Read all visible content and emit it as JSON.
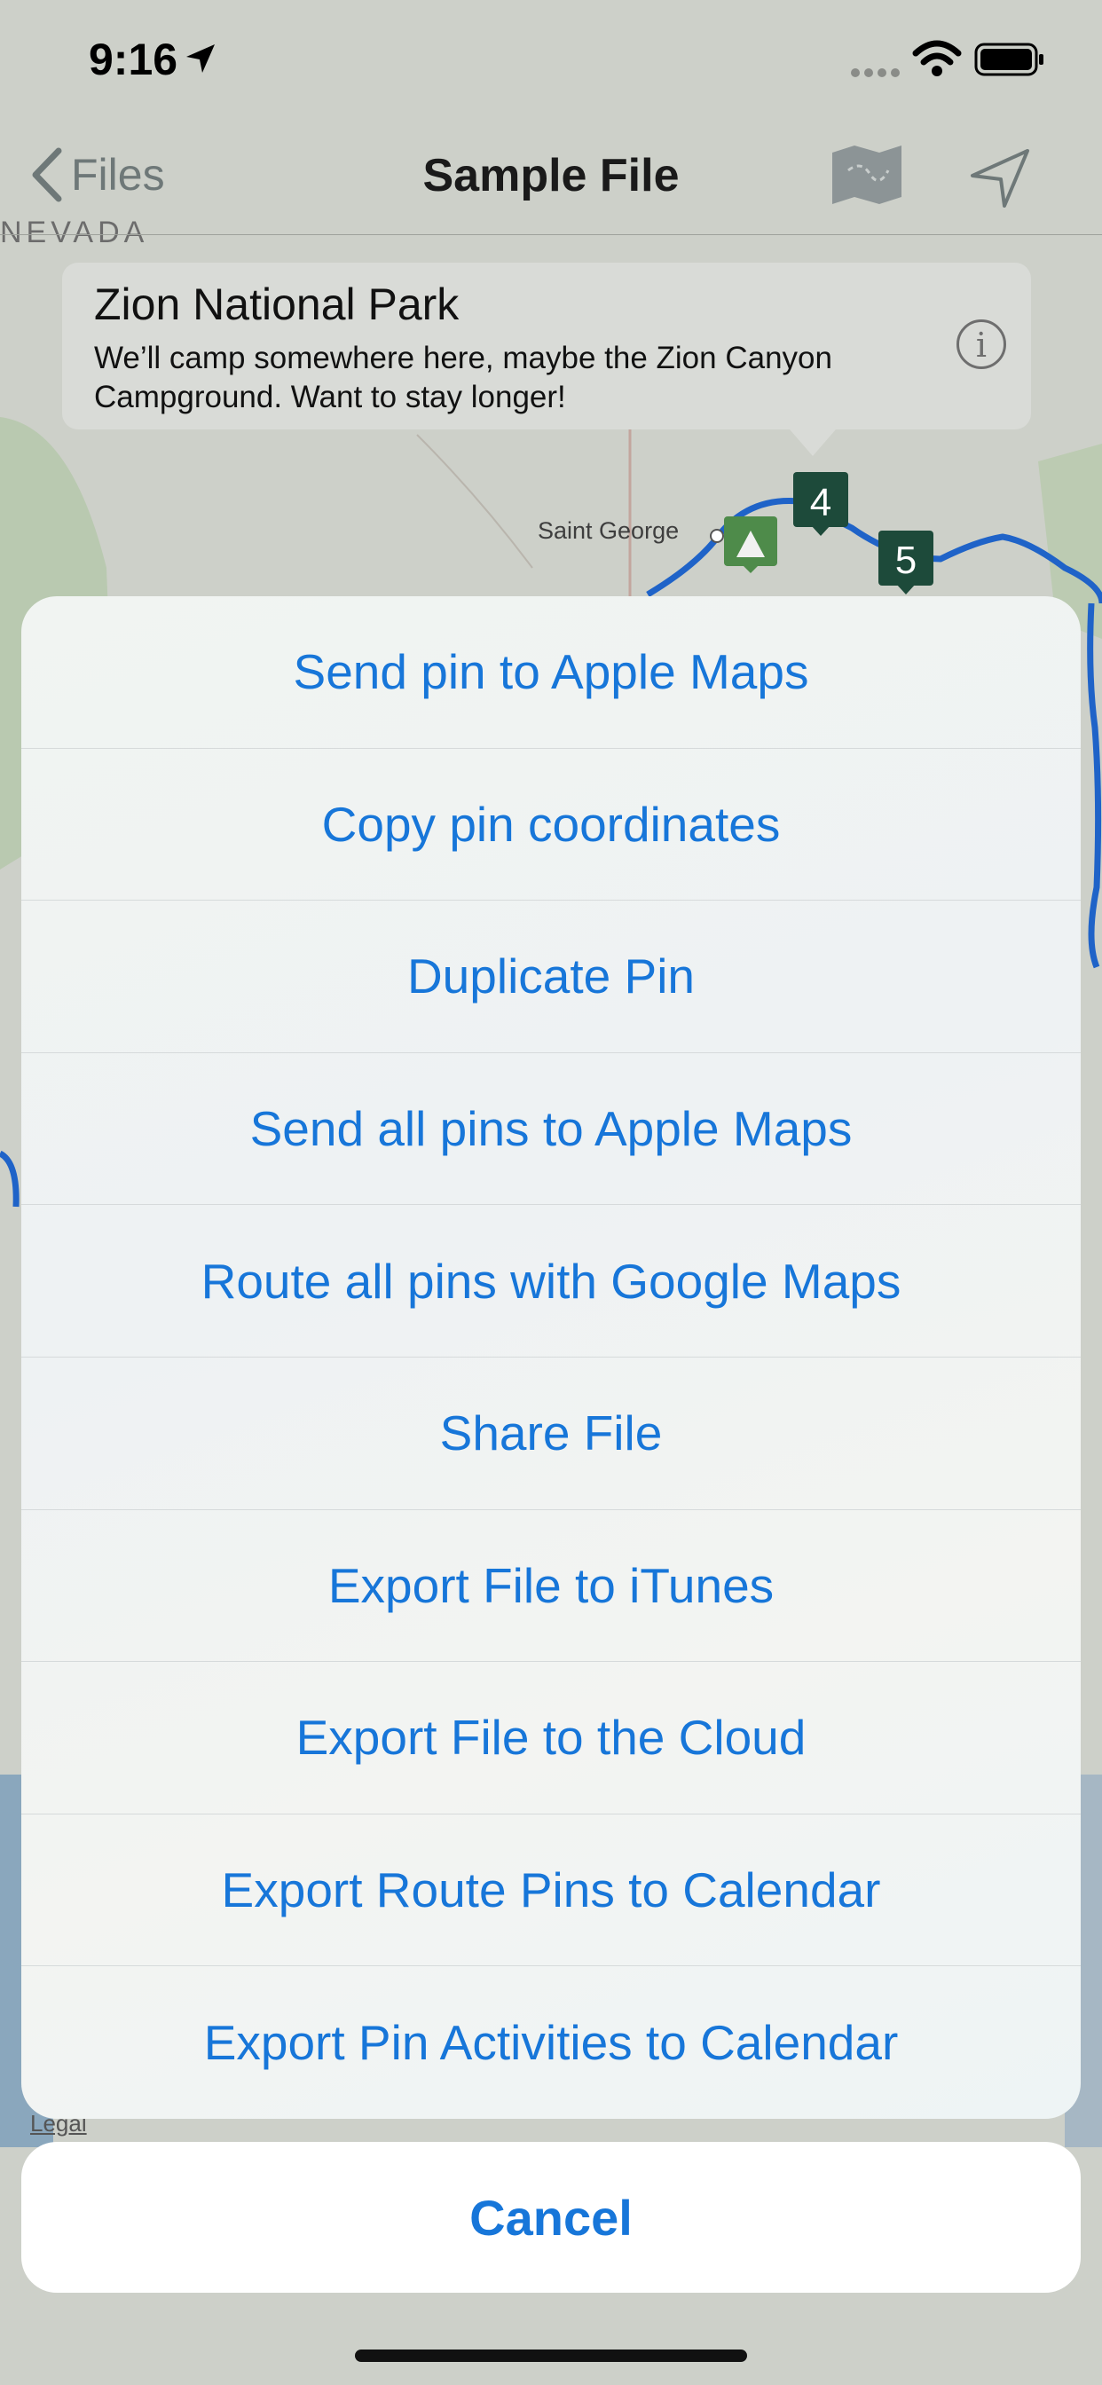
{
  "status_bar": {
    "time": "9:16"
  },
  "nav": {
    "back_label": "Files",
    "title": "Sample File"
  },
  "map": {
    "region_label": "NEVADA",
    "city_label": "Saint George",
    "pins": [
      "4",
      "5"
    ],
    "legal": "Legal"
  },
  "callout": {
    "title": "Zion National Park",
    "body": "We’ll camp somewhere here, maybe the Zion Canyon Campground.  Want to stay longer!"
  },
  "action_sheet": {
    "items": [
      "Send pin to Apple Maps",
      "Copy pin coordinates",
      "Duplicate Pin",
      "Send all pins to Apple Maps",
      "Route all pins with Google Maps",
      "Share File",
      "Export File to iTunes",
      "Export File to the Cloud",
      "Export Route Pins to Calendar",
      "Export Pin Activities to Calendar"
    ],
    "cancel": "Cancel"
  },
  "colors": {
    "accent": "#1776d9",
    "route": "#1f63c8",
    "pin": "#1d4a3a",
    "park": "#b8cdae"
  }
}
